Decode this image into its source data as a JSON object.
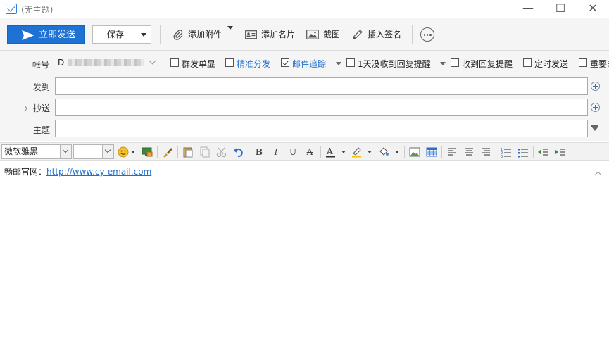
{
  "window": {
    "title": "(无主题)",
    "minimize": "—",
    "maximize": "☐",
    "close": "✕"
  },
  "toolbar": {
    "send_label": "立即发送",
    "save_label": "保存",
    "attach_label": "添加附件",
    "card_label": "添加名片",
    "screenshot_label": "截图",
    "signature_label": "插入签名"
  },
  "header": {
    "account_label": "帐号",
    "account_value": "D",
    "options": {
      "group_single": "群发单显",
      "precise_split": "精准分发",
      "tracking": "邮件追踪",
      "one_day_reminder": "1天没收到回复提醒",
      "reply_reminder": "收到回复提醒",
      "scheduled_send": "定时发送",
      "important": "重要邮"
    },
    "to_label": "发到",
    "cc_label": "抄送",
    "subject_label": "主题",
    "to_value": "",
    "cc_value": "",
    "subject_value": ""
  },
  "format": {
    "font_name": "微软雅黑",
    "font_size": ""
  },
  "editor": {
    "prefix": "畅邮官网：",
    "link": "http://www.cy-email.com"
  },
  "colors": {
    "accent": "#1e72d4",
    "link": "#1e6fce",
    "toolbar_bg": "#f5f5f5"
  }
}
